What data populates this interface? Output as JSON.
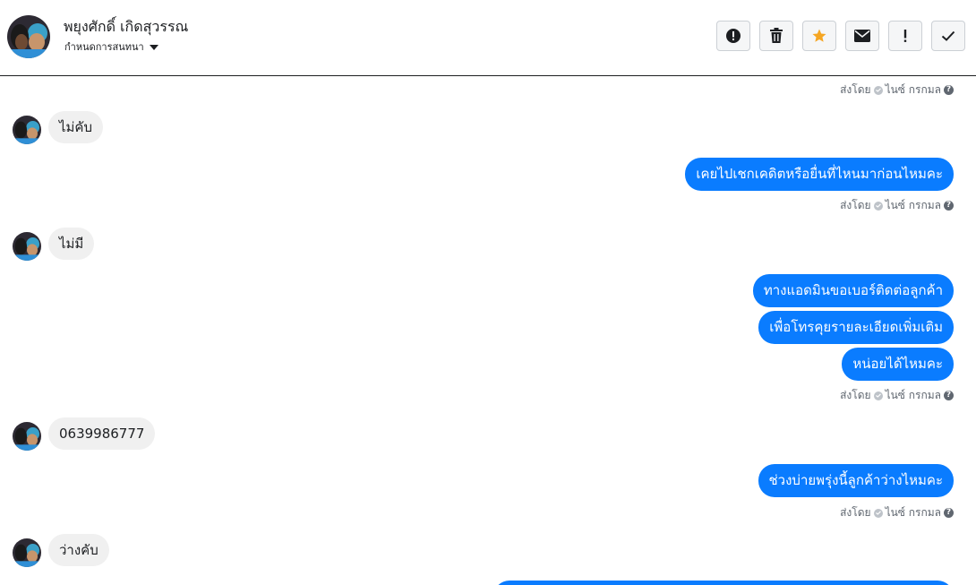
{
  "header": {
    "contact_name": "พยุงศักดิ์ เกิดสุวรรณ",
    "assign_label": "กำหนดการสนทนา",
    "tools": [
      {
        "name": "alert-button",
        "icon": "alert-circle-icon"
      },
      {
        "name": "delete-button",
        "icon": "trash-icon"
      },
      {
        "name": "star-button",
        "icon": "star-icon"
      },
      {
        "name": "mark-unread-button",
        "icon": "envelope-icon"
      },
      {
        "name": "priority-button",
        "icon": "exclamation-icon"
      },
      {
        "name": "done-button",
        "icon": "check-icon"
      }
    ]
  },
  "colors": {
    "outgoing_bubble": "#0a7cff",
    "incoming_bubble": "#f0f0f0",
    "star": "#f5a623"
  },
  "sent_label": {
    "prefix": "ส่งโดย",
    "agent": "ไนซ์ กรกมล"
  },
  "messages": {
    "m1": "ไม่คับ",
    "m2": "เคยไปเชกเคดิตหรือยื่นที่ไหนมาก่อนไหมคะ",
    "m3": "ไม่มี",
    "m4": "ทางแอดมินขอเบอร์ติดต่อลูกค้า",
    "m5": "เพื่อโทรคุยรายละเอียดเพิ่มเติม",
    "m6": "หน่อยได้ไหมคะ",
    "m7": "0639986777",
    "m8": "ช่วงบ่ายพรุ่งนี้ลูกค้าว่างไหมคะ",
    "m9": "ว่างคับ"
  }
}
